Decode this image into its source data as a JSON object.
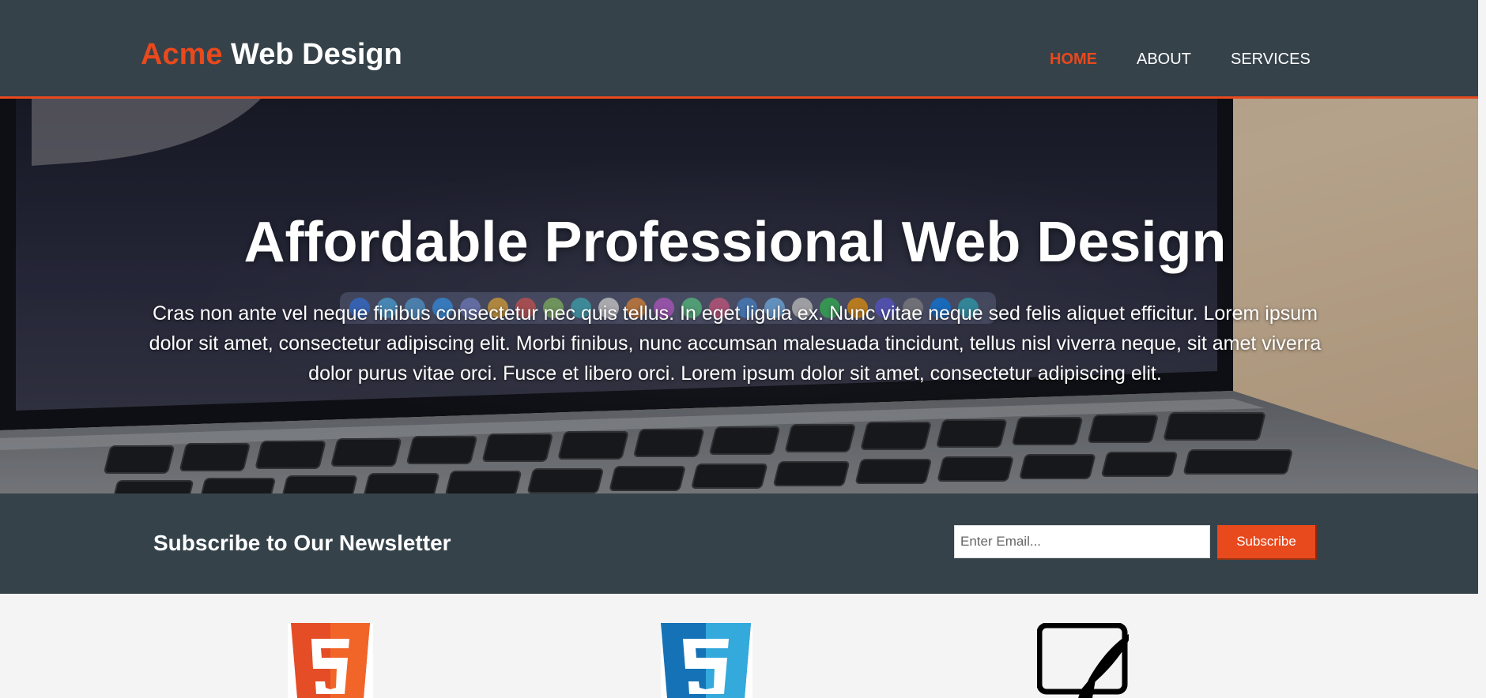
{
  "header": {
    "brand_highlight": "Acme",
    "brand_rest": " Web Design",
    "nav": [
      {
        "label": "HOME",
        "active": true
      },
      {
        "label": "ABOUT",
        "active": false
      },
      {
        "label": "SERVICES",
        "active": false
      }
    ]
  },
  "showcase": {
    "title": "Affordable Professional Web Design",
    "text": "Cras non ante vel neque finibus consectetur nec quis tellus. In eget ligula ex. Nunc vitae neque sed felis aliquet efficitur. Lorem ipsum dolor sit amet, consectetur adipiscing elit. Morbi finibus, nunc accumsan malesuada tincidunt, tellus nisl viverra neque, sit amet viverra dolor purus vitae orci. Fusce et libero orci. Lorem ipsum dolor sit amet, consectetur adipiscing elit.",
    "background_icon": "laptop-keyboard-photo"
  },
  "newsletter": {
    "heading": "Subscribe to Our Newsletter",
    "email_placeholder": "Enter Email...",
    "email_value": "",
    "subscribe_label": "Subscribe"
  },
  "boxes": {
    "icons": [
      "html5-logo-icon",
      "css3-logo-icon",
      "monitor-design-icon"
    ]
  },
  "colors": {
    "header_bg": "#35424a",
    "accent": "#e8491d",
    "page_bg": "#f4f4f4",
    "html5_orange": "#e44d26",
    "css3_blue": "#1572b6"
  }
}
